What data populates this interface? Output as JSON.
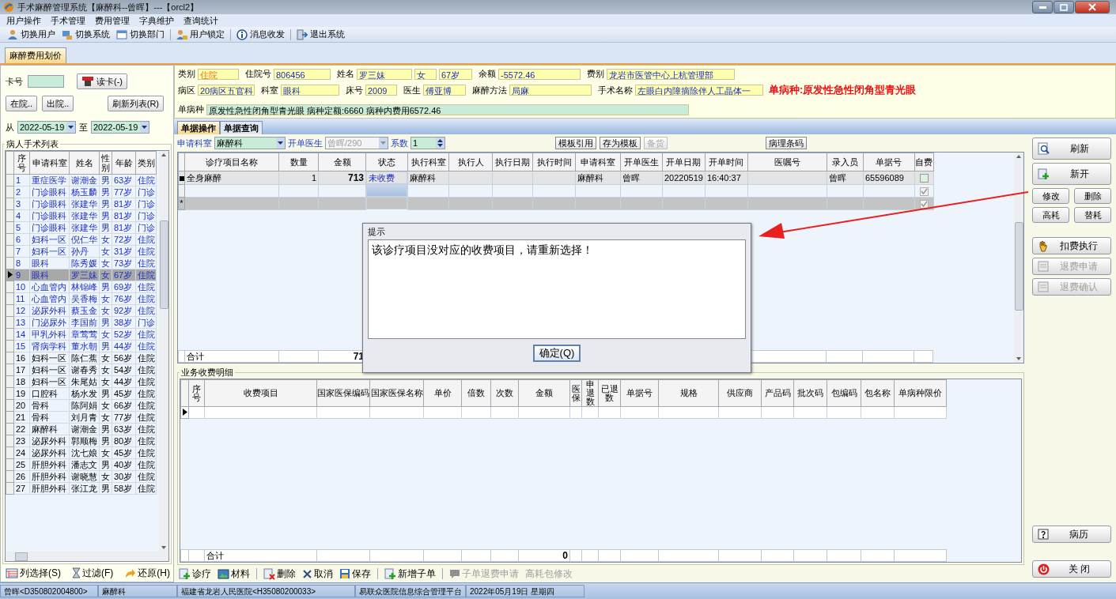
{
  "window": {
    "title": "手术麻醉管理系统【麻醉科--曾晖】---【orcl2】"
  },
  "menu": [
    "用户操作",
    "手术管理",
    "费用管理",
    "字典维护",
    "查询统计"
  ],
  "toolbar": [
    "切换用户",
    "切换系统",
    "切换部门",
    "用户锁定",
    "消息收发",
    "退出系统"
  ],
  "main_tabs": [
    {
      "label": "麻醉费用划价",
      "selected": true
    }
  ],
  "left": {
    "card_label": "卡号",
    "read_card": "读卡(-)",
    "buttons": [
      "在院..",
      "出院..",
      "刷新列表(R)"
    ],
    "from_label": "从",
    "from_date": "2022-05-19",
    "to_label": "至",
    "to_date": "2022-05-19",
    "group_title": "病人手术列表",
    "columns": [
      "序号",
      "申请科室",
      "姓名",
      "性别",
      "年龄",
      "类别"
    ],
    "rows": [
      {
        "cells": [
          "1",
          "重症医学",
          "谢潮金",
          "男",
          "63岁",
          "住院"
        ],
        "selected": false,
        "marked": true
      },
      {
        "cells": [
          "2",
          "门诊眼科",
          "杨玉麟",
          "男",
          "77岁",
          "门诊"
        ],
        "selected": false,
        "marked": true
      },
      {
        "cells": [
          "3",
          "门诊眼科",
          "张建华",
          "男",
          "81岁",
          "门诊"
        ],
        "selected": false,
        "marked": true
      },
      {
        "cells": [
          "4",
          "门诊眼科",
          "张建华",
          "男",
          "81岁",
          "门诊"
        ],
        "selected": false,
        "marked": true
      },
      {
        "cells": [
          "5",
          "门诊眼科",
          "张建华",
          "男",
          "81岁",
          "门诊"
        ],
        "selected": false,
        "marked": true
      },
      {
        "cells": [
          "6",
          "妇科一区",
          "倪仁华",
          "女",
          "72岁",
          "住院"
        ],
        "selected": false,
        "marked": true
      },
      {
        "cells": [
          "7",
          "妇科一区",
          "孙丹",
          "女",
          "31岁",
          "住院"
        ],
        "selected": false,
        "marked": true
      },
      {
        "cells": [
          "8",
          "眼科",
          "陈秀媛",
          "女",
          "73岁",
          "住院"
        ],
        "selected": false,
        "marked": true
      },
      {
        "cells": [
          "9",
          "眼科",
          "罗三妹",
          "女",
          "67岁",
          "住院"
        ],
        "selected": true,
        "marked": true
      },
      {
        "cells": [
          "10",
          "心血管内",
          "林锦峰",
          "男",
          "69岁",
          "住院"
        ],
        "selected": false,
        "marked": true
      },
      {
        "cells": [
          "11",
          "心血管内",
          "吴香梅",
          "女",
          "76岁",
          "住院"
        ],
        "selected": false,
        "marked": true
      },
      {
        "cells": [
          "12",
          "泌尿外科",
          "蔡玉金",
          "女",
          "92岁",
          "住院"
        ],
        "selected": false,
        "marked": true
      },
      {
        "cells": [
          "13",
          "门泌尿外",
          "李国前",
          "男",
          "38岁",
          "门诊"
        ],
        "selected": false,
        "marked": true
      },
      {
        "cells": [
          "14",
          "甲乳外科",
          "章莺莺",
          "女",
          "52岁",
          "住院"
        ],
        "selected": false,
        "marked": true
      },
      {
        "cells": [
          "15",
          "肾病学科",
          "董水朝",
          "男",
          "44岁",
          "住院"
        ],
        "selected": false,
        "marked": true
      },
      {
        "cells": [
          "16",
          "妇科一区",
          "陈仁蕉",
          "女",
          "56岁",
          "住院"
        ],
        "selected": false,
        "marked": false
      },
      {
        "cells": [
          "17",
          "妇科一区",
          "谢春秀",
          "女",
          "54岁",
          "住院"
        ],
        "selected": false,
        "marked": false
      },
      {
        "cells": [
          "18",
          "妇科一区",
          "朱尾姑",
          "女",
          "44岁",
          "住院"
        ],
        "selected": false,
        "marked": false
      },
      {
        "cells": [
          "19",
          "口腔科",
          "杨水发",
          "男",
          "45岁",
          "住院"
        ],
        "selected": false,
        "marked": false
      },
      {
        "cells": [
          "20",
          "骨科",
          "陈阿娟",
          "女",
          "66岁",
          "住院"
        ],
        "selected": false,
        "marked": false
      },
      {
        "cells": [
          "21",
          "骨科",
          "刘月青",
          "女",
          "77岁",
          "住院"
        ],
        "selected": false,
        "marked": false
      },
      {
        "cells": [
          "22",
          "麻醉科",
          "谢潮金",
          "男",
          "63岁",
          "住院"
        ],
        "selected": false,
        "marked": false
      },
      {
        "cells": [
          "23",
          "泌尿外科",
          "郭顺梅",
          "男",
          "80岁",
          "住院"
        ],
        "selected": false,
        "marked": false
      },
      {
        "cells": [
          "24",
          "泌尿外科",
          "沈七娘",
          "女",
          "45岁",
          "住院"
        ],
        "selected": false,
        "marked": false
      },
      {
        "cells": [
          "25",
          "肝胆外科",
          "潘志文",
          "男",
          "40岁",
          "住院"
        ],
        "selected": false,
        "marked": false
      },
      {
        "cells": [
          "26",
          "肝胆外科",
          "谢晓慧",
          "女",
          "30岁",
          "住院"
        ],
        "selected": false,
        "marked": false
      },
      {
        "cells": [
          "27",
          "肝胆外科",
          "张江龙",
          "男",
          "58岁",
          "住院"
        ],
        "selected": false,
        "marked": false
      }
    ],
    "actions": [
      "列选择(S)",
      "过滤(F)",
      "还原(H)"
    ]
  },
  "patient": {
    "row1": [
      {
        "label": "类别",
        "value": "住院",
        "highlighted": true
      },
      {
        "label": "住院号",
        "value": "806456",
        "highlighted": false
      },
      {
        "label": "姓名",
        "value": "罗三妹",
        "highlighted": false
      },
      {
        "value": "女",
        "highlighted": false
      },
      {
        "value": "67岁",
        "highlighted": false
      },
      {
        "label": "余额",
        "value": "-5572.46",
        "highlighted": false
      },
      {
        "label": "费别",
        "value": "龙岩市医管中心上杭管理部",
        "highlighted": false
      }
    ],
    "row2": [
      {
        "label": "病区",
        "value": "20病区五官科"
      },
      {
        "label": "科室",
        "value": "眼科"
      },
      {
        "label": "床号",
        "value": "2009"
      },
      {
        "label": "医生",
        "value": "傅亚博"
      },
      {
        "label": "麻醉方法",
        "value": "局麻"
      },
      {
        "label": "手术名称",
        "value": "左眼白内障摘除伴人工晶体一"
      }
    ],
    "alert": "单病种:原发性急性闭角型青光眼",
    "disease_label": "单病种",
    "disease_value": "原发性急性闭角型青光眼 病种定额:6660 病种内费用6572.46"
  },
  "tabs": [
    {
      "label": "单据操作",
      "selected": true
    },
    {
      "label": "单据查询",
      "selected": false
    }
  ],
  "form": {
    "dept_label": "申请科室",
    "dept": "麻醉科",
    "doctor_label": "开单医生",
    "doctor": "曾晖/290",
    "doctor_disabled": true,
    "factor_label": "系数",
    "factor": "1",
    "buttons": [
      {
        "label": "模板引用",
        "disabled": false
      },
      {
        "label": "存为模板",
        "disabled": false
      },
      {
        "label": "备货",
        "disabled": true
      },
      {
        "label": "病理条码",
        "disabled": false
      }
    ]
  },
  "upper_table": {
    "columns": [
      "诊疗项目名称",
      "数量",
      "金额",
      "状态",
      "执行科室",
      "执行人",
      "执行日期",
      "执行时间",
      "申请科室",
      "开单医生",
      "开单日期",
      "开单时间",
      "医嘱号",
      "录入员",
      "单据号",
      "自费"
    ],
    "rows": [
      {
        "current": true,
        "self_pay": false,
        "item": "全身麻醉",
        "qty": "1",
        "amount": "713",
        "status": "未收费",
        "exec_dept": "麻醉科",
        "apply_dept": "麻醉科",
        "doctor": "曾晖",
        "date": "20220519",
        "time": "16:40:37",
        "entered_by": "曾晖",
        "doc_no": "65596089"
      },
      {
        "current": false,
        "self_pay": true
      },
      {
        "current": false,
        "self_pay": true,
        "marker": "*"
      }
    ],
    "footer_label": "合计",
    "footer_amount": "71"
  },
  "lower_group": "业务收费明细",
  "lower_table": {
    "columns": [
      "序号",
      "收费项目",
      "国家医保编码",
      "国家医保名称",
      "单价",
      "倍数",
      "次数",
      "金额",
      "医保",
      "申退数",
      "已退数",
      "单据号",
      "规格",
      "供应商",
      "产品码",
      "批次码",
      "包编码",
      "包名称",
      "单病种限价"
    ],
    "rows": [
      {
        "current": true
      }
    ],
    "footer_label": "合计",
    "footer_amount": "0"
  },
  "bottom_toolbar": [
    {
      "label": "诊疗",
      "disabled": false
    },
    {
      "label": "材料",
      "disabled": false
    },
    {
      "label": "删除",
      "disabled": false
    },
    {
      "label": "取消",
      "disabled": false
    },
    {
      "label": "保存",
      "disabled": false
    },
    {
      "label": "新增子单",
      "disabled": false
    },
    {
      "label": "子单退费申请",
      "disabled": true
    },
    {
      "label": "高耗包修改",
      "disabled": true
    }
  ],
  "side_actions": [
    {
      "label": "刷新",
      "kind": "large",
      "disabled": false
    },
    {
      "label": "新开",
      "kind": "large",
      "disabled": false
    },
    {
      "label": "修改",
      "kind": "small",
      "disabled": false
    },
    {
      "label": "删除",
      "kind": "small",
      "disabled": false
    },
    {
      "label": "高耗",
      "kind": "small",
      "disabled": false
    },
    {
      "label": "替耗",
      "kind": "small",
      "disabled": false
    },
    {
      "label": "扣费执行",
      "kind": "large",
      "disabled": false
    },
    {
      "label": "退费申请",
      "kind": "large",
      "disabled": true
    },
    {
      "label": "退费确认",
      "kind": "large",
      "disabled": true
    }
  ],
  "side_footer": [
    {
      "label": "病历",
      "disabled": false
    },
    {
      "label": "关 闭",
      "disabled": false
    }
  ],
  "dialog": {
    "title": "提示",
    "message": "该诊疗项目没对应的收费项目，请重新选择！",
    "button": "确定(Q)"
  },
  "status_bar": [
    "曾晖<D350802004800>",
    "麻醉科",
    "福建省龙岩人民医院<H35080200033>",
    "易联众医院信息综合管理平台",
    "2022年05月19日 星期四"
  ]
}
